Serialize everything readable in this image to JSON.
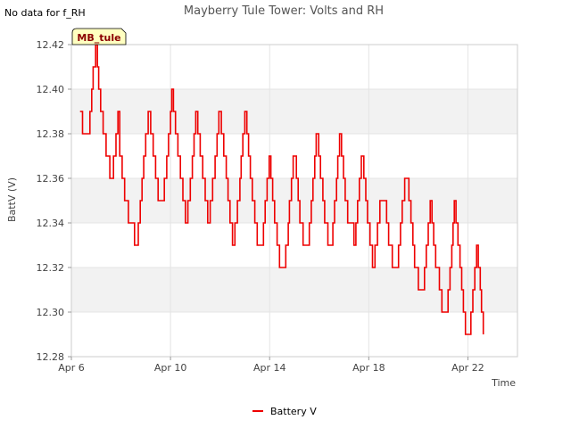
{
  "no_data_note": "No data for f_RH",
  "chart_data": {
    "type": "line",
    "title": "Mayberry Tule Tower: Volts and RH",
    "xlabel": "Time",
    "ylabel": "BattV (V)",
    "x_unit": "days since Apr 6",
    "xlim": [
      0,
      18
    ],
    "ylim": [
      12.28,
      12.42
    ],
    "x_ticks": [
      {
        "x": 0,
        "label": "Apr 6"
      },
      {
        "x": 4,
        "label": "Apr 10"
      },
      {
        "x": 8,
        "label": "Apr 14"
      },
      {
        "x": 12,
        "label": "Apr 18"
      },
      {
        "x": 16,
        "label": "Apr 22"
      }
    ],
    "y_ticks": [
      {
        "y": 12.28,
        "label": "12.28"
      },
      {
        "y": 12.3,
        "label": "12.30"
      },
      {
        "y": 12.32,
        "label": "12.32"
      },
      {
        "y": 12.34,
        "label": "12.34"
      },
      {
        "y": 12.36,
        "label": "12.36"
      },
      {
        "y": 12.38,
        "label": "12.38"
      },
      {
        "y": 12.4,
        "label": "12.40"
      },
      {
        "y": 12.42,
        "label": "12.42"
      }
    ],
    "grid": true,
    "legend_position": "bottom-center",
    "station_badge": "MB_tule",
    "colors": {
      "series": "#ee0000",
      "band": "#f2f2f2",
      "badge_bg": "#ffffc0",
      "badge_text": "#8b0000"
    },
    "series": [
      {
        "name": "Battery V",
        "points": [
          [
            0.35,
            12.39
          ],
          [
            0.45,
            12.38
          ],
          [
            0.65,
            12.38
          ],
          [
            0.75,
            12.39
          ],
          [
            0.82,
            12.4
          ],
          [
            0.88,
            12.41
          ],
          [
            0.98,
            12.42
          ],
          [
            1.05,
            12.41
          ],
          [
            1.1,
            12.4
          ],
          [
            1.18,
            12.39
          ],
          [
            1.28,
            12.38
          ],
          [
            1.4,
            12.37
          ],
          [
            1.55,
            12.36
          ],
          [
            1.7,
            12.37
          ],
          [
            1.8,
            12.38
          ],
          [
            1.88,
            12.39
          ],
          [
            1.95,
            12.37
          ],
          [
            2.05,
            12.36
          ],
          [
            2.15,
            12.35
          ],
          [
            2.3,
            12.34
          ],
          [
            2.45,
            12.34
          ],
          [
            2.55,
            12.33
          ],
          [
            2.7,
            12.34
          ],
          [
            2.78,
            12.35
          ],
          [
            2.85,
            12.36
          ],
          [
            2.92,
            12.37
          ],
          [
            3.0,
            12.38
          ],
          [
            3.1,
            12.39
          ],
          [
            3.2,
            12.38
          ],
          [
            3.3,
            12.37
          ],
          [
            3.4,
            12.36
          ],
          [
            3.5,
            12.35
          ],
          [
            3.65,
            12.35
          ],
          [
            3.75,
            12.36
          ],
          [
            3.85,
            12.37
          ],
          [
            3.92,
            12.38
          ],
          [
            4.0,
            12.39
          ],
          [
            4.05,
            12.4
          ],
          [
            4.12,
            12.39
          ],
          [
            4.2,
            12.38
          ],
          [
            4.3,
            12.37
          ],
          [
            4.4,
            12.36
          ],
          [
            4.5,
            12.35
          ],
          [
            4.6,
            12.34
          ],
          [
            4.7,
            12.35
          ],
          [
            4.8,
            12.36
          ],
          [
            4.88,
            12.37
          ],
          [
            4.95,
            12.38
          ],
          [
            5.02,
            12.39
          ],
          [
            5.1,
            12.38
          ],
          [
            5.2,
            12.37
          ],
          [
            5.3,
            12.36
          ],
          [
            5.4,
            12.35
          ],
          [
            5.5,
            12.34
          ],
          [
            5.6,
            12.35
          ],
          [
            5.7,
            12.36
          ],
          [
            5.8,
            12.37
          ],
          [
            5.88,
            12.38
          ],
          [
            5.95,
            12.39
          ],
          [
            6.05,
            12.38
          ],
          [
            6.15,
            12.37
          ],
          [
            6.25,
            12.36
          ],
          [
            6.32,
            12.35
          ],
          [
            6.4,
            12.34
          ],
          [
            6.5,
            12.33
          ],
          [
            6.6,
            12.34
          ],
          [
            6.7,
            12.35
          ],
          [
            6.8,
            12.36
          ],
          [
            6.85,
            12.37
          ],
          [
            6.92,
            12.38
          ],
          [
            7.0,
            12.39
          ],
          [
            7.08,
            12.38
          ],
          [
            7.15,
            12.37
          ],
          [
            7.22,
            12.36
          ],
          [
            7.3,
            12.35
          ],
          [
            7.4,
            12.34
          ],
          [
            7.5,
            12.33
          ],
          [
            7.65,
            12.33
          ],
          [
            7.75,
            12.34
          ],
          [
            7.82,
            12.35
          ],
          [
            7.9,
            12.36
          ],
          [
            7.98,
            12.37
          ],
          [
            8.05,
            12.36
          ],
          [
            8.12,
            12.35
          ],
          [
            8.2,
            12.34
          ],
          [
            8.3,
            12.33
          ],
          [
            8.4,
            12.32
          ],
          [
            8.55,
            12.32
          ],
          [
            8.65,
            12.33
          ],
          [
            8.75,
            12.34
          ],
          [
            8.8,
            12.35
          ],
          [
            8.88,
            12.36
          ],
          [
            8.95,
            12.37
          ],
          [
            9.08,
            12.36
          ],
          [
            9.15,
            12.35
          ],
          [
            9.22,
            12.34
          ],
          [
            9.35,
            12.33
          ],
          [
            9.5,
            12.33
          ],
          [
            9.6,
            12.34
          ],
          [
            9.68,
            12.35
          ],
          [
            9.75,
            12.36
          ],
          [
            9.82,
            12.37
          ],
          [
            9.88,
            12.38
          ],
          [
            9.98,
            12.37
          ],
          [
            10.05,
            12.36
          ],
          [
            10.15,
            12.35
          ],
          [
            10.22,
            12.34
          ],
          [
            10.35,
            12.33
          ],
          [
            10.45,
            12.33
          ],
          [
            10.55,
            12.34
          ],
          [
            10.62,
            12.35
          ],
          [
            10.7,
            12.36
          ],
          [
            10.75,
            12.37
          ],
          [
            10.82,
            12.38
          ],
          [
            10.9,
            12.37
          ],
          [
            10.98,
            12.36
          ],
          [
            11.05,
            12.35
          ],
          [
            11.15,
            12.34
          ],
          [
            11.3,
            12.34
          ],
          [
            11.4,
            12.33
          ],
          [
            11.48,
            12.34
          ],
          [
            11.55,
            12.35
          ],
          [
            11.62,
            12.36
          ],
          [
            11.7,
            12.37
          ],
          [
            11.8,
            12.36
          ],
          [
            11.88,
            12.35
          ],
          [
            11.95,
            12.34
          ],
          [
            12.05,
            12.33
          ],
          [
            12.15,
            12.32
          ],
          [
            12.25,
            12.33
          ],
          [
            12.35,
            12.34
          ],
          [
            12.45,
            12.35
          ],
          [
            12.62,
            12.35
          ],
          [
            12.72,
            12.34
          ],
          [
            12.8,
            12.33
          ],
          [
            12.95,
            12.32
          ],
          [
            13.1,
            12.32
          ],
          [
            13.2,
            12.33
          ],
          [
            13.28,
            12.34
          ],
          [
            13.35,
            12.35
          ],
          [
            13.45,
            12.36
          ],
          [
            13.55,
            12.36
          ],
          [
            13.62,
            12.35
          ],
          [
            13.7,
            12.34
          ],
          [
            13.78,
            12.33
          ],
          [
            13.85,
            12.32
          ],
          [
            14.0,
            12.31
          ],
          [
            14.15,
            12.31
          ],
          [
            14.25,
            12.32
          ],
          [
            14.32,
            12.33
          ],
          [
            14.4,
            12.34
          ],
          [
            14.48,
            12.35
          ],
          [
            14.55,
            12.34
          ],
          [
            14.62,
            12.33
          ],
          [
            14.7,
            12.32
          ],
          [
            14.85,
            12.31
          ],
          [
            14.95,
            12.3
          ],
          [
            15.1,
            12.3
          ],
          [
            15.2,
            12.31
          ],
          [
            15.28,
            12.32
          ],
          [
            15.35,
            12.33
          ],
          [
            15.4,
            12.34
          ],
          [
            15.45,
            12.35
          ],
          [
            15.52,
            12.34
          ],
          [
            15.6,
            12.33
          ],
          [
            15.68,
            12.32
          ],
          [
            15.75,
            12.31
          ],
          [
            15.82,
            12.3
          ],
          [
            15.9,
            12.29
          ],
          [
            16.05,
            12.29
          ],
          [
            16.12,
            12.3
          ],
          [
            16.2,
            12.31
          ],
          [
            16.28,
            12.32
          ],
          [
            16.35,
            12.33
          ],
          [
            16.42,
            12.32
          ],
          [
            16.5,
            12.31
          ],
          [
            16.55,
            12.3
          ],
          [
            16.6,
            12.3
          ],
          [
            16.62,
            12.29
          ]
        ]
      }
    ]
  }
}
